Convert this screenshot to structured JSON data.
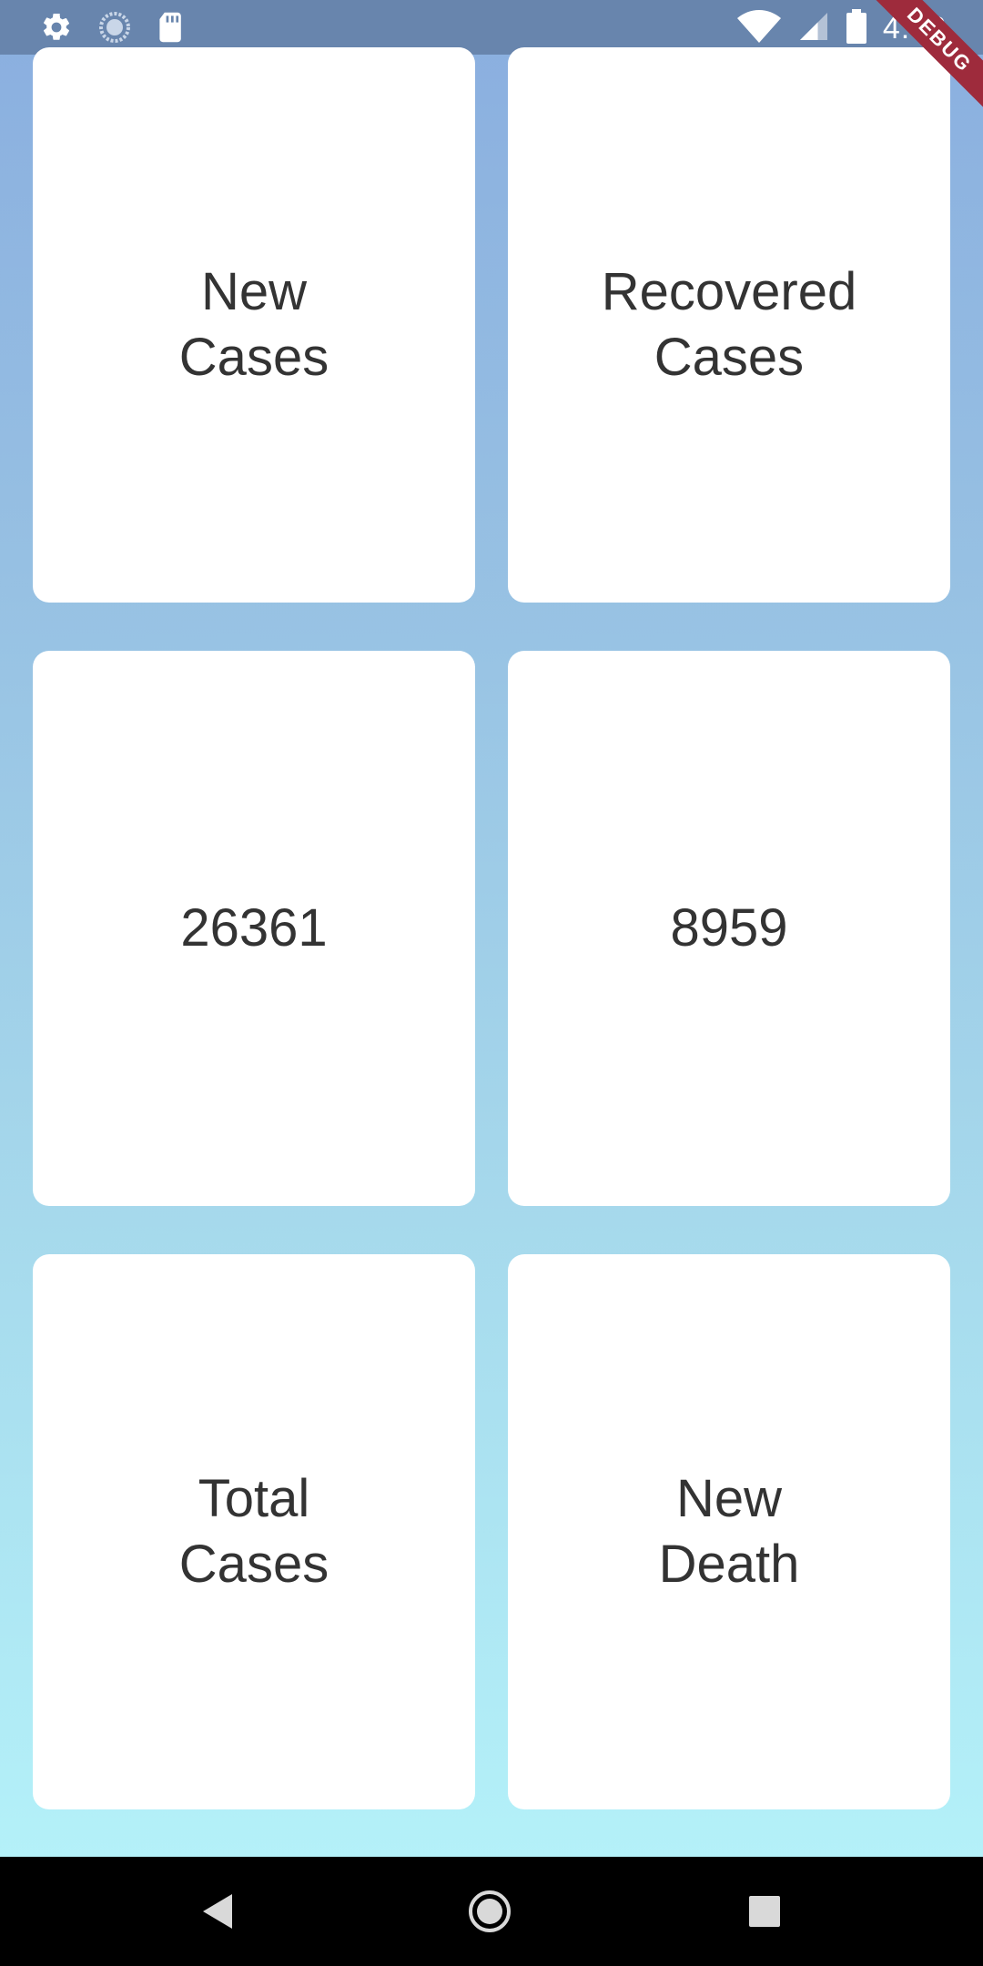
{
  "status_bar": {
    "time": "4:52",
    "left_icons": [
      "gear-icon",
      "loading-spinner-icon",
      "sd-card-icon"
    ],
    "right_icons": [
      "wifi-icon",
      "cell-signal-icon",
      "battery-icon"
    ],
    "background": "#6885ad"
  },
  "debug_banner": {
    "label": "DEBUG"
  },
  "cards": [
    {
      "id": "new-cases-label",
      "text": "New\nCases"
    },
    {
      "id": "recovered-cases-label",
      "text": "Recovered\nCases"
    },
    {
      "id": "new-cases-value",
      "text": "26361"
    },
    {
      "id": "recovered-cases-value",
      "text": "8959"
    },
    {
      "id": "total-cases-label",
      "text": "Total\nCases"
    },
    {
      "id": "new-death-label",
      "text": "New\nDeath"
    }
  ],
  "navigation": {
    "buttons": [
      "back-icon",
      "home-icon",
      "recents-icon"
    ]
  },
  "colors": {
    "gradient_top": "#8aaedf",
    "gradient_bottom": "#b6f5fb",
    "card_text": "#333333",
    "debug_ribbon": "#9e2b3c"
  }
}
